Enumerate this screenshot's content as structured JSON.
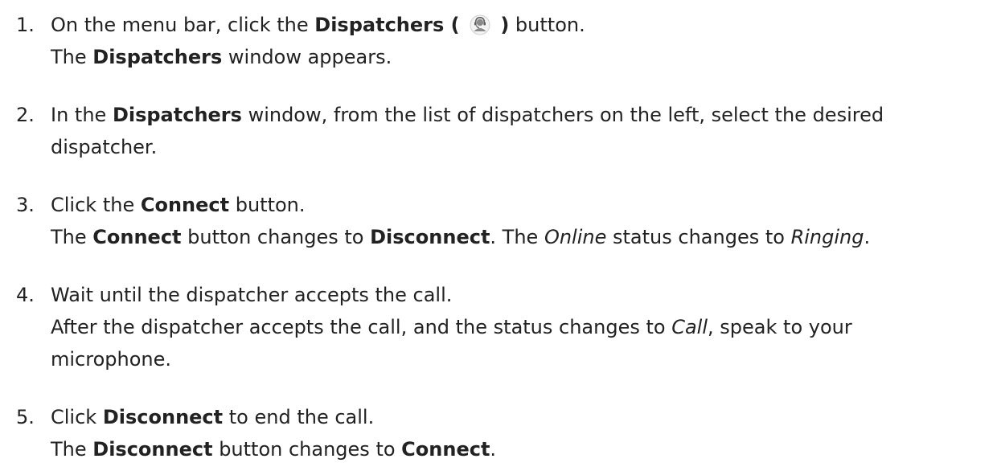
{
  "steps": [
    {
      "number": "1.",
      "instruction_pre": "On the menu bar, click the ",
      "button_name": "Dispatchers",
      "icon_open": " ( ",
      "icon": "dispatcher-headset-icon",
      "icon_close": " )",
      "instruction_post": " button.",
      "result_pre": "The ",
      "result_bold": "Dispatchers",
      "result_post": " window appears."
    },
    {
      "number": "2.",
      "line1_pre": "In the ",
      "line1_bold": "Dispatchers",
      "line1_post": " window, from the list of dispatchers on the left, select the desired",
      "line2": "dispatcher."
    },
    {
      "number": "3.",
      "instruction_pre": "Click the ",
      "instruction_bold": "Connect",
      "instruction_post": " button.",
      "result_pre": "The ",
      "result_bold1": "Connect",
      "result_mid1": " button changes to ",
      "result_bold2": "Disconnect",
      "result_mid2": ". The ",
      "result_italic1": "Online",
      "result_mid3": " status changes to ",
      "result_italic2": "Ringing",
      "result_post": "."
    },
    {
      "number": "4.",
      "instruction": "Wait until the dispatcher accepts the call.",
      "result_line1_pre": "After the dispatcher accepts the call, and the status changes to ",
      "result_line1_italic": "Call",
      "result_line1_post": ", speak to your",
      "result_line2": "microphone."
    },
    {
      "number": "5.",
      "instruction_pre": "Click ",
      "instruction_bold": "Disconnect",
      "instruction_post": " to end the call.",
      "result_pre": "The ",
      "result_bold1": "Disconnect",
      "result_mid": " button changes to ",
      "result_bold2": "Connect",
      "result_post": "."
    }
  ]
}
